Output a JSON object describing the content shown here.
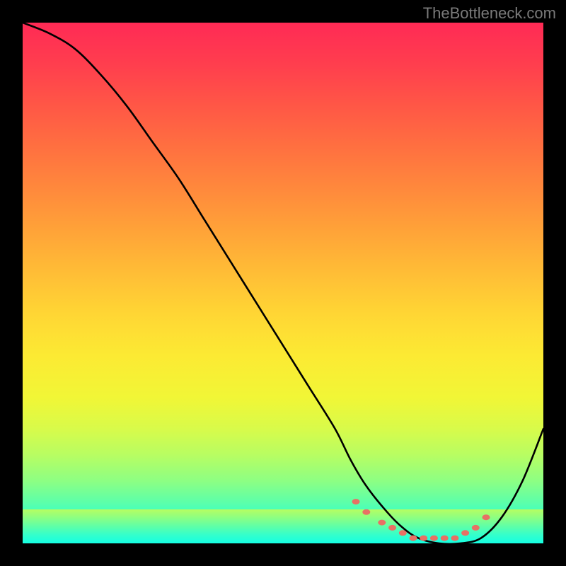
{
  "attribution": "TheBottleneck.com",
  "chart_data": {
    "type": "line",
    "title": "",
    "xlabel": "",
    "ylabel": "",
    "xlim": [
      0,
      100
    ],
    "ylim": [
      0,
      100
    ],
    "colors": {
      "curve": "#000000",
      "markers": "#e87064",
      "gradient_top": "#ff2a55",
      "gradient_bottom": "#11ffe4"
    },
    "series": [
      {
        "name": "bottleneck-curve",
        "x": [
          0,
          5,
          10,
          15,
          20,
          25,
          30,
          35,
          40,
          45,
          50,
          55,
          60,
          63,
          66,
          70,
          73,
          76,
          80,
          84,
          88,
          92,
          96,
          100
        ],
        "y": [
          100,
          98,
          95,
          90,
          84,
          77,
          70,
          62,
          54,
          46,
          38,
          30,
          22,
          16,
          11,
          6,
          3,
          1,
          0,
          0,
          1,
          5,
          12,
          22
        ]
      }
    ],
    "markers": {
      "name": "optimal-range-dots",
      "x": [
        64,
        66,
        69,
        71,
        73,
        75,
        77,
        79,
        81,
        83,
        85,
        87,
        89
      ],
      "y": [
        8,
        6,
        4,
        3,
        2,
        1,
        1,
        1,
        1,
        1,
        2,
        3,
        5
      ]
    }
  }
}
